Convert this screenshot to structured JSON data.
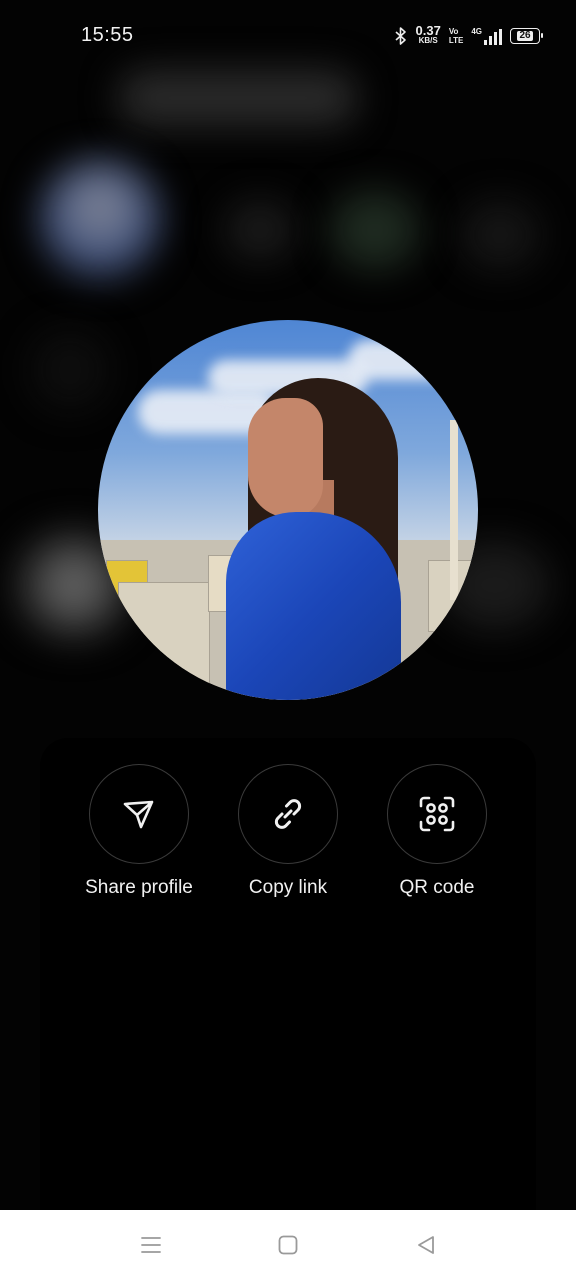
{
  "status_bar": {
    "time": "15:55",
    "net_speed_value": "0.37",
    "net_speed_unit": "KB/S",
    "volte_top": "Vo",
    "volte_bottom": "LTE",
    "network": "4G",
    "battery": "26",
    "icons": [
      "bluetooth-icon",
      "signal-icon",
      "battery-icon"
    ]
  },
  "profile": {
    "photo_icon": "profile-photo"
  },
  "actions": [
    {
      "label": "Share profile",
      "icon": "send-icon"
    },
    {
      "label": "Copy link",
      "icon": "link-icon"
    },
    {
      "label": "QR code",
      "icon": "qr-scan-icon"
    }
  ],
  "navigation": {
    "icons": [
      "menu-icon",
      "home-icon",
      "back-icon"
    ]
  },
  "colors": {
    "background": "#000000",
    "text": "#f1f1f1",
    "ring": "#3a3a3a",
    "nav_bar": "#ffffff",
    "nav_icon": "#9a9a9a"
  }
}
